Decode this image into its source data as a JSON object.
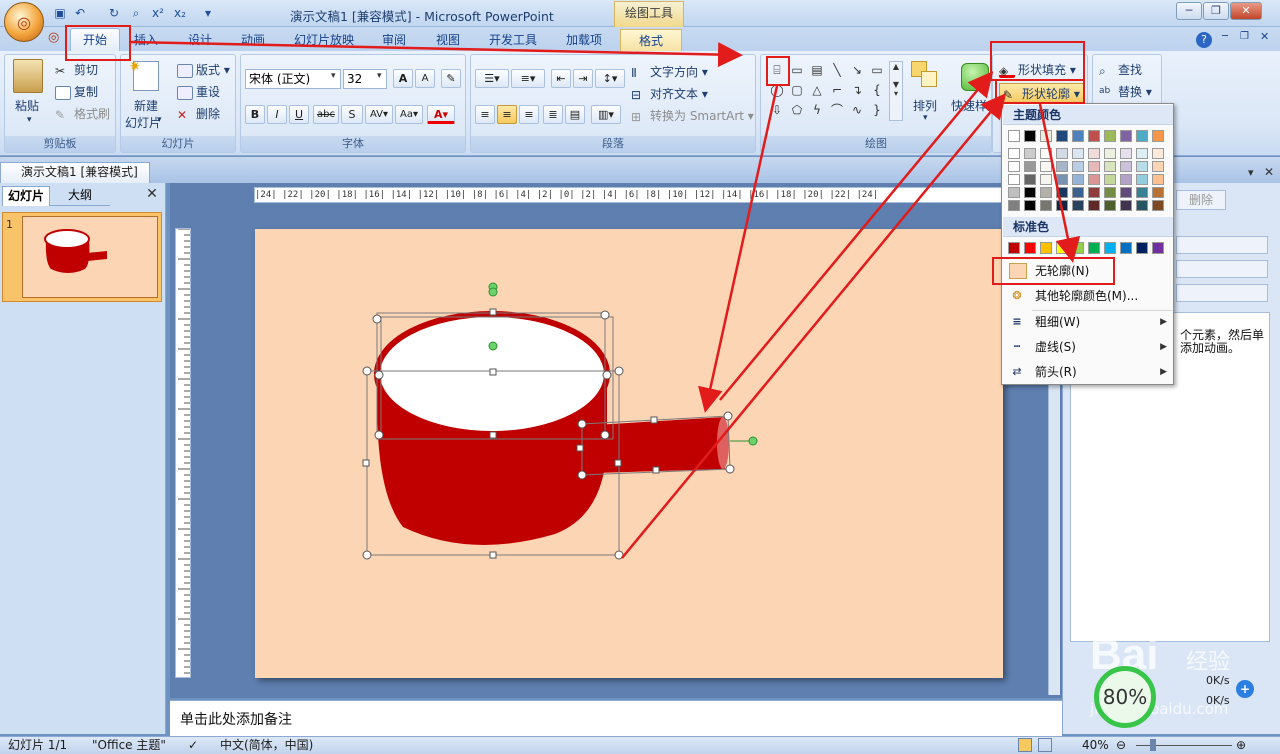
{
  "window": {
    "title": "演示文稿1 [兼容模式] - Microsoft PowerPoint",
    "contextual_tab": "绘图工具"
  },
  "tabs": [
    "开始",
    "插入",
    "设计",
    "动画",
    "幻灯片放映",
    "审阅",
    "视图",
    "开发工具",
    "加载项",
    "格式"
  ],
  "clipboard": {
    "paste": "粘贴",
    "cut": "剪切",
    "copy": "复制",
    "format_painter": "格式刷",
    "label": "剪贴板"
  },
  "slides_group": {
    "new_slide": "新建",
    "new_slide2": "幻灯片",
    "layout": "版式",
    "reset": "重设",
    "delete": "删除",
    "label": "幻灯片"
  },
  "font_group": {
    "font_name": "宋体 (正文)",
    "font_size": "32",
    "label": "字体"
  },
  "paragraph_group": {
    "text_direction": "文字方向",
    "align_text": "对齐文本",
    "convert_smartart": "转换为 SmartArt",
    "label": "段落"
  },
  "drawing_group": {
    "arrange": "排列",
    "quick_styles": "快速样式",
    "shape_fill": "形状填充",
    "shape_outline": "形状轮廓",
    "label": "绘图"
  },
  "editing_group": {
    "find": "查找",
    "replace": "替换"
  },
  "doc_tab": "演示文稿1 [兼容模式]",
  "left_panel": {
    "tab_slides": "幻灯片",
    "tab_outline": "大纲",
    "slide_number": "1"
  },
  "ruler_labels": "|24|  |22|  |20|  |18|  |16|  |14|  |12|  |10|  |8|  |6|  |4|  |2|  |0|  |2|  |4|  |6|  |8|  |10|  |12|  |14|  |16|  |18|  |20|  |22|  |24|",
  "notes_placeholder": "单击此处添加备注",
  "outline_menu": {
    "theme_colors": "主题颜色",
    "standard_colors": "标准色",
    "no_outline": "无轮廓(N)",
    "more_colors": "其他轮廓颜色(M)...",
    "weight": "粗细(W)",
    "dashes": "虚线(S)",
    "arrows": "箭头(R)",
    "theme_top_row": [
      "#ffffff",
      "#000000",
      "#eeece1",
      "#1f497d",
      "#4f81bd",
      "#c0504d",
      "#9bbb59",
      "#8064a2",
      "#4bacc6",
      "#f79646"
    ],
    "standard_row": [
      "#c00000",
      "#ff0000",
      "#ffc000",
      "#ffff00",
      "#92d050",
      "#00b050",
      "#00b0f0",
      "#0070c0",
      "#002060",
      "#7030a0"
    ]
  },
  "right_pane": {
    "delete_btn": "删除",
    "hint_line1": "个元素，然后单",
    "hint_line2": "添加动画。",
    "speed1": "0K/s",
    "speed2": "0K/s",
    "percent": "80%"
  },
  "status": {
    "slide": "幻灯片 1/1",
    "theme": "\"Office 主题\"",
    "language": "中文(简体，中国)",
    "zoom": "40%"
  },
  "watermark": {
    "brand": "Bai",
    "brand_cn": "经验",
    "url": "jingyan.baidu.com"
  }
}
